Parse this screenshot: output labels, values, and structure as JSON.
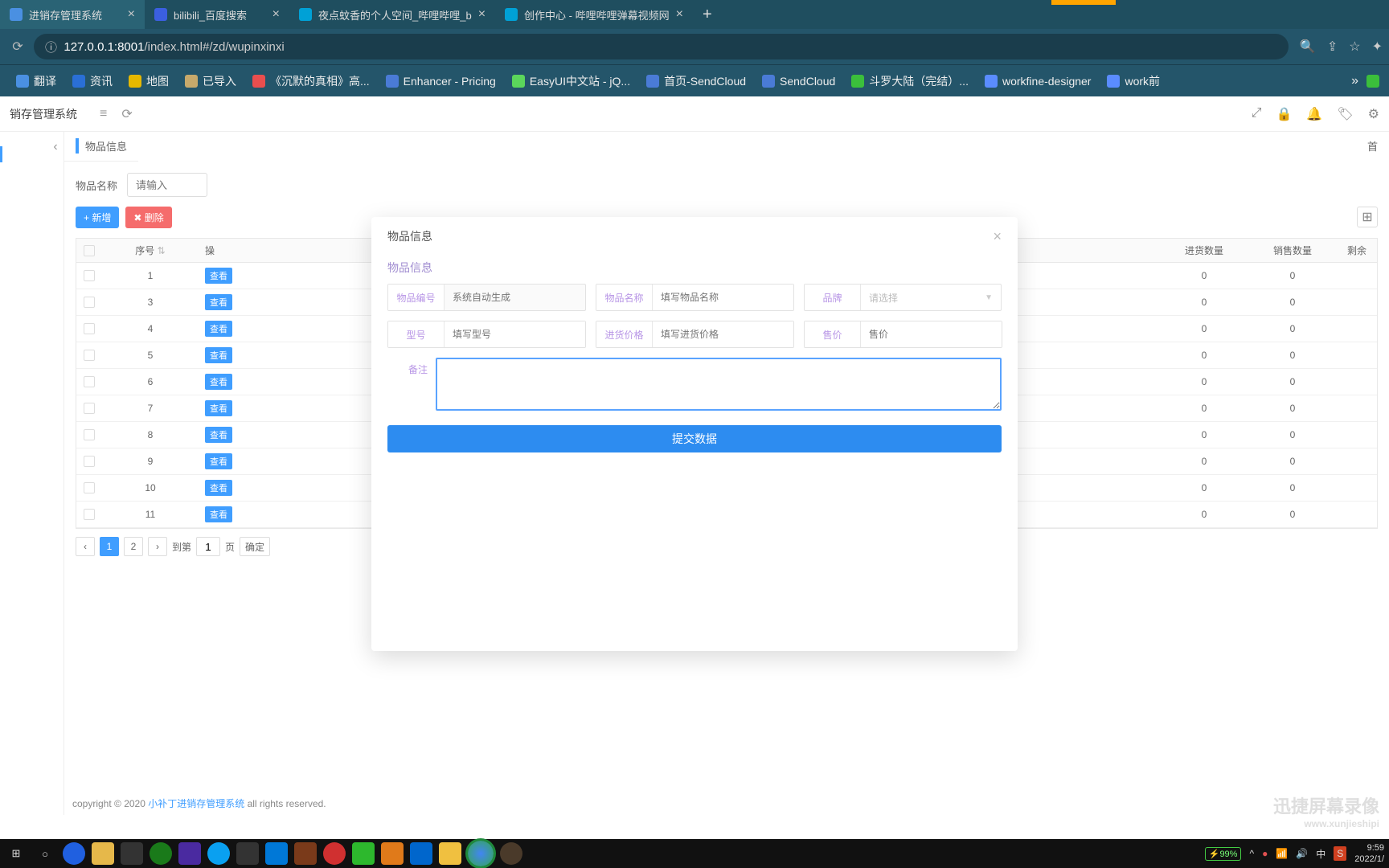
{
  "browser": {
    "tabs": [
      {
        "title": "进销存管理系统"
      },
      {
        "title": "bilibili_百度搜索"
      },
      {
        "title": "夜点蚊香的个人空间_哔哩哔哩_b"
      },
      {
        "title": "创作中心 - 哔哩哔哩弹幕视频网"
      }
    ],
    "url_prefix": "127.0.0.1:8001",
    "url_path": "/index.html#/zd/wupinxinxi",
    "url_scheme": "ⓘ"
  },
  "bookmarks": [
    {
      "label": "翻译",
      "color": "#4a90e2"
    },
    {
      "label": "资讯",
      "color": "#2a6fd6"
    },
    {
      "label": "地图",
      "color": "#e6b800"
    },
    {
      "label": "已导入",
      "color": "#c7a96b"
    },
    {
      "label": "《沉默的真相》高...",
      "color": "#e94e4e"
    },
    {
      "label": "Enhancer - Pricing",
      "color": "#4a7bd6"
    },
    {
      "label": "EasyUI中文站 - jQ...",
      "color": "#5bd65b"
    },
    {
      "label": "首页-SendCloud",
      "color": "#4a7bd6"
    },
    {
      "label": "SendCloud",
      "color": "#4a7bd6"
    },
    {
      "label": "斗罗大陆（完结）...",
      "color": "#3bbf3b"
    },
    {
      "label": "workfine-designer",
      "color": "#5a8cff"
    },
    {
      "label": "work前",
      "color": "#5a8cff"
    }
  ],
  "app": {
    "title": "销存管理系统",
    "collapse_icon": "≡",
    "refresh_icon": "⟳",
    "tab_title": "物品信息",
    "right_link": "首",
    "top_icons": [
      "⤢",
      "🔒",
      "🔔",
      "🏷",
      "⚙"
    ]
  },
  "search": {
    "label": "物品名称",
    "placeholder": "请输入"
  },
  "buttons": {
    "add": "+ 新增",
    "delete": "✖ 删除"
  },
  "table": {
    "headers": {
      "seq": "序号",
      "op": "操",
      "in": "进货数量",
      "out": "销售数量",
      "rest": "剩余"
    },
    "sort_icon": "⇅",
    "rows": [
      {
        "seq": "1",
        "in": "0",
        "out": "0"
      },
      {
        "seq": "3",
        "in": "0",
        "out": "0"
      },
      {
        "seq": "4",
        "in": "0",
        "out": "0"
      },
      {
        "seq": "5",
        "in": "0",
        "out": "0"
      },
      {
        "seq": "6",
        "in": "0",
        "out": "0"
      },
      {
        "seq": "7",
        "in": "0",
        "out": "0"
      },
      {
        "seq": "8",
        "in": "0",
        "out": "0"
      },
      {
        "seq": "9",
        "in": "0",
        "out": "0"
      },
      {
        "seq": "10",
        "in": "0",
        "out": "0"
      },
      {
        "seq": "11",
        "in": "0",
        "out": "0"
      }
    ],
    "view_tag": "查看"
  },
  "pager": {
    "p1": "1",
    "p2": "2",
    "goto": "到第",
    "page": "页",
    "confirm": "确定",
    "val": "1"
  },
  "modal": {
    "title": "物品信息",
    "section": "物品信息",
    "fields": {
      "code_lbl": "物品编号",
      "code_ph": "系统自动生成",
      "name_lbl": "物品名称",
      "name_ph": "填写物品名称",
      "brand_lbl": "品牌",
      "brand_ph": "请选择",
      "model_lbl": "型号",
      "model_ph": "填写型号",
      "inprice_lbl": "进货价格",
      "inprice_ph": "填写进货价格",
      "price_lbl": "售价",
      "price_ph": "售价",
      "remark_lbl": "备注"
    },
    "submit": "提交数据"
  },
  "footer": {
    "copy": "copyright © 2020 ",
    "link": "小补丁进销存管理系统",
    "rest": " all rights reserved."
  },
  "tray": {
    "battery": "99%",
    "ime": "中",
    "time": "9:59",
    "date": "2022/1/"
  },
  "watermark": {
    "title": "迅捷屏幕录像",
    "url": "www.xunjieshipi"
  }
}
